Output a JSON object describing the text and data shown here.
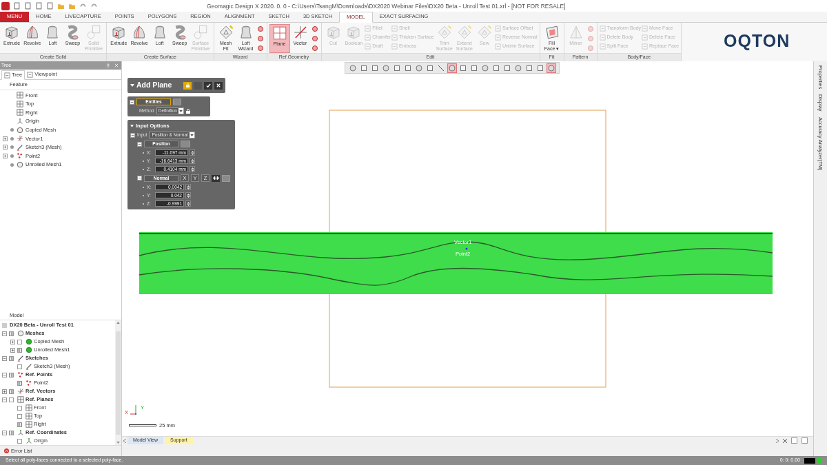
{
  "window": {
    "title": "Geomagic Design X 2020. 0. 0 - C:\\Users\\TsangM\\Downloads\\DX2020 Webinar Files\\DX20 Beta - Unroll Test 01.xrl - [NOT FOR RESALE]"
  },
  "menu_tabs": [
    {
      "label": "MENU",
      "kind": "menu",
      "selected": false
    },
    {
      "label": "HOME",
      "kind": "tab",
      "selected": false
    },
    {
      "label": "LIVECAPTURE",
      "kind": "tab",
      "selected": false
    },
    {
      "label": "POINTS",
      "kind": "tab",
      "selected": false
    },
    {
      "label": "POLYGONS",
      "kind": "tab",
      "selected": false
    },
    {
      "label": "REGION",
      "kind": "tab",
      "selected": false
    },
    {
      "label": "ALIGNMENT",
      "kind": "tab",
      "selected": false
    },
    {
      "label": "SKETCH",
      "kind": "tab",
      "selected": false
    },
    {
      "label": "3D SKETCH",
      "kind": "tab",
      "selected": false
    },
    {
      "label": "MODEL",
      "kind": "tab",
      "selected": true
    },
    {
      "label": "EXACT SURFACING",
      "kind": "tab",
      "selected": false
    }
  ],
  "ribbon": {
    "groups": [
      {
        "label": "Create Solid",
        "buttons": [
          {
            "label": "Extrude",
            "kind": "large",
            "disabled": false,
            "active": false
          },
          {
            "label": "Revolve",
            "kind": "large",
            "disabled": false,
            "active": false
          },
          {
            "label": "Loft",
            "kind": "large",
            "disabled": false,
            "active": false
          },
          {
            "label": "Sweep",
            "kind": "large",
            "disabled": false,
            "active": false
          },
          {
            "label": "Solid\nPrimitive",
            "kind": "large",
            "disabled": true,
            "active": false
          }
        ]
      },
      {
        "label": "Create Surface",
        "buttons": [
          {
            "label": "Extrude",
            "kind": "large",
            "disabled": false,
            "active": false
          },
          {
            "label": "Revolve",
            "kind": "large",
            "disabled": false,
            "active": false
          },
          {
            "label": "Loft",
            "kind": "large",
            "disabled": false,
            "active": false
          },
          {
            "label": "Sweep",
            "kind": "large",
            "disabled": false,
            "active": false
          },
          {
            "label": "Surface\nPrimitive",
            "kind": "large",
            "disabled": true,
            "active": false
          }
        ]
      },
      {
        "label": "Wizard",
        "buttons": [
          {
            "label": "Mesh\nFit",
            "kind": "large",
            "disabled": false,
            "active": false
          },
          {
            "label": "Loft\nWizard",
            "kind": "large",
            "disabled": false,
            "active": false
          },
          {
            "kind": "icon",
            "disabled": false,
            "active": false
          },
          {
            "kind": "icon",
            "disabled": false,
            "active": false
          },
          {
            "kind": "icon",
            "disabled": false,
            "active": false
          }
        ]
      },
      {
        "label": "Ref.Geometry",
        "buttons": [
          {
            "label": "Plane",
            "kind": "large",
            "disabled": false,
            "active": true
          },
          {
            "label": "Vector",
            "kind": "large",
            "disabled": false,
            "active": false
          },
          {
            "kind": "icon",
            "disabled": false,
            "active": false
          },
          {
            "kind": "icon",
            "disabled": false,
            "active": false
          },
          {
            "kind": "icon",
            "disabled": false,
            "active": false
          }
        ]
      },
      {
        "label": "Edit",
        "buttons": [
          {
            "label": "Cut",
            "kind": "large",
            "disabled": true,
            "active": false
          },
          {
            "label": "Boolean",
            "kind": "large",
            "disabled": true,
            "active": false
          },
          {
            "label": "Fillet",
            "kind": "small",
            "disabled": true,
            "active": false
          },
          {
            "label": "Chamfer",
            "kind": "small",
            "disabled": true,
            "active": false
          },
          {
            "label": "Draft",
            "kind": "small",
            "disabled": true,
            "active": false
          },
          {
            "label": "Shell",
            "kind": "small",
            "disabled": true,
            "active": false
          },
          {
            "label": "Thicken Surface",
            "kind": "small",
            "disabled": true,
            "active": false
          },
          {
            "label": "Emboss",
            "kind": "small",
            "disabled": true,
            "active": false
          },
          {
            "label": "Trim\nSurface",
            "kind": "large",
            "disabled": true,
            "active": false
          },
          {
            "label": "Extend\nSurface",
            "kind": "large",
            "disabled": true,
            "active": false
          },
          {
            "label": "Sew",
            "kind": "large",
            "disabled": true,
            "active": false
          },
          {
            "label": "Surface Offset",
            "kind": "small",
            "disabled": true,
            "active": false
          },
          {
            "label": "Reverse Normal",
            "kind": "small",
            "disabled": true,
            "active": false
          },
          {
            "label": "Untrim Surface",
            "kind": "small",
            "disabled": true,
            "active": false
          }
        ]
      },
      {
        "label": "Fit",
        "buttons": [
          {
            "label": "Fill\nFace ▾",
            "kind": "large",
            "disabled": false,
            "active": false
          }
        ]
      },
      {
        "label": "Pattern",
        "buttons": [
          {
            "label": "Mirror",
            "kind": "large",
            "disabled": true,
            "active": false
          },
          {
            "kind": "icon",
            "disabled": true,
            "active": false
          },
          {
            "kind": "icon",
            "disabled": true,
            "active": false
          },
          {
            "kind": "icon",
            "disabled": true,
            "active": false
          }
        ]
      },
      {
        "label": "Body/Face",
        "buttons": [
          {
            "label": "Transform Body",
            "kind": "small",
            "disabled": true,
            "active": false
          },
          {
            "label": "Delete Body",
            "kind": "small",
            "disabled": true,
            "active": false
          },
          {
            "label": "Split Face",
            "kind": "small",
            "disabled": true,
            "active": false
          },
          {
            "label": "Move Face",
            "kind": "small",
            "disabled": true,
            "active": false
          },
          {
            "label": "Delete Face",
            "kind": "small",
            "disabled": true,
            "active": false
          },
          {
            "label": "Replace Face",
            "kind": "small",
            "disabled": true,
            "active": false
          }
        ]
      }
    ]
  },
  "logo": {
    "text": "OQTON"
  },
  "tree_panel": {
    "title": "Tree",
    "tabs": [
      {
        "label": "Tree",
        "selected": true
      },
      {
        "label": "Viewpoint",
        "selected": false
      }
    ],
    "header": "Feature",
    "items": [
      {
        "label": "Front",
        "kind": "plane"
      },
      {
        "label": "Top",
        "kind": "plane"
      },
      {
        "label": "Right",
        "kind": "plane"
      },
      {
        "label": "Origin",
        "kind": "coord"
      },
      {
        "label": "Copied Mesh",
        "kind": "mesh",
        "visible": true
      },
      {
        "label": "Vector1",
        "kind": "vector",
        "visible": true,
        "expanded": false
      },
      {
        "label": "Sketch3 (Mesh)",
        "kind": "sketch",
        "visible": true,
        "expanded": false
      },
      {
        "label": "Point2",
        "kind": "points",
        "visible": true,
        "expanded": false
      },
      {
        "label": "Unrolled Mesh1",
        "kind": "mesh",
        "visible": true
      }
    ]
  },
  "model_panel": {
    "header": "Model",
    "root": "DX20 Beta - Unroll Test 01",
    "items": [
      {
        "label": "Meshes",
        "kind": "mesh",
        "visible": true,
        "expanded": true,
        "children": [
          {
            "label": "Copied Mesh",
            "kind": "body",
            "visible": false,
            "expanded": false
          },
          {
            "label": "Unrolled Mesh1",
            "kind": "body",
            "visible": true,
            "expanded": false
          }
        ]
      },
      {
        "label": "Sketches",
        "kind": "sketch",
        "visible": true,
        "expanded": true,
        "children": [
          {
            "label": "Sketch3 (Mesh)",
            "kind": "sketch",
            "visible": false
          }
        ]
      },
      {
        "label": "Ref. Points",
        "kind": "points",
        "visible": true,
        "expanded": true,
        "children": [
          {
            "label": "Point2",
            "kind": "points",
            "visible": true
          }
        ]
      },
      {
        "label": "Ref. Vectors",
        "kind": "vector",
        "visible": true,
        "expanded": false
      },
      {
        "label": "Ref. Planes",
        "kind": "plane",
        "visible": false,
        "expanded": true,
        "children": [
          {
            "label": "Front",
            "kind": "plane",
            "visible": false
          },
          {
            "label": "Top",
            "kind": "plane",
            "visible": false
          },
          {
            "label": "Right",
            "kind": "plane",
            "visible": true
          }
        ]
      },
      {
        "label": "Ref. Coordinates",
        "kind": "coord",
        "visible": true,
        "expanded": true,
        "children": [
          {
            "label": "Origin",
            "kind": "coord",
            "visible": false
          }
        ]
      }
    ]
  },
  "error_list": {
    "label": "Error List"
  },
  "view_toolbar": [
    {
      "selected": false
    },
    {
      "selected": false
    },
    {
      "selected": false
    },
    {
      "selected": false
    },
    {
      "selected": false
    },
    {
      "selected": false
    },
    {
      "selected": false
    },
    {
      "selected": false
    },
    {
      "selected": false
    },
    {
      "selected": true
    },
    {
      "selected": false
    },
    {
      "selected": false
    },
    {
      "selected": false
    },
    {
      "selected": false
    },
    {
      "selected": false
    },
    {
      "selected": false
    },
    {
      "selected": false
    },
    {
      "selected": false
    },
    {
      "selected": true
    }
  ],
  "dialog": {
    "title": "Add Plane",
    "entities": "Entities",
    "method_label": "Method",
    "method_value": "Definition",
    "input_options": "Input Options",
    "input_label": "Input",
    "input_value": "Position & Normal",
    "position": {
      "label": "Position",
      "fields": [
        {
          "axis": "X:",
          "value": "-11.097 mm"
        },
        {
          "axis": "Y:",
          "value": "-16.6413 mm"
        },
        {
          "axis": "Z:",
          "value": "0.4104 mm"
        }
      ]
    },
    "normal": {
      "label": "Normal",
      "axes": [
        "X",
        "Y",
        "Z"
      ],
      "fields": [
        {
          "axis": "X:",
          "value": "0.0042"
        },
        {
          "axis": "Y:",
          "value": "0.042"
        },
        {
          "axis": "Z:",
          "value": "-0.9991"
        }
      ]
    }
  },
  "viewport": {
    "labels": [
      "Vector1",
      "Point2"
    ],
    "scale": "25 mm",
    "axes": [
      "X",
      "Y"
    ]
  },
  "view_tabs": [
    {
      "label": "Model View",
      "selected": false
    },
    {
      "label": "Support",
      "selected": true
    }
  ],
  "side_tabs": [
    "Properties",
    "Display",
    "Accuracy Analyzer(TM)"
  ],
  "status_bar": {
    "message": "Select all poly-faces connected to a selected poly-face.",
    "readout": "0: 0: 0.00"
  }
}
